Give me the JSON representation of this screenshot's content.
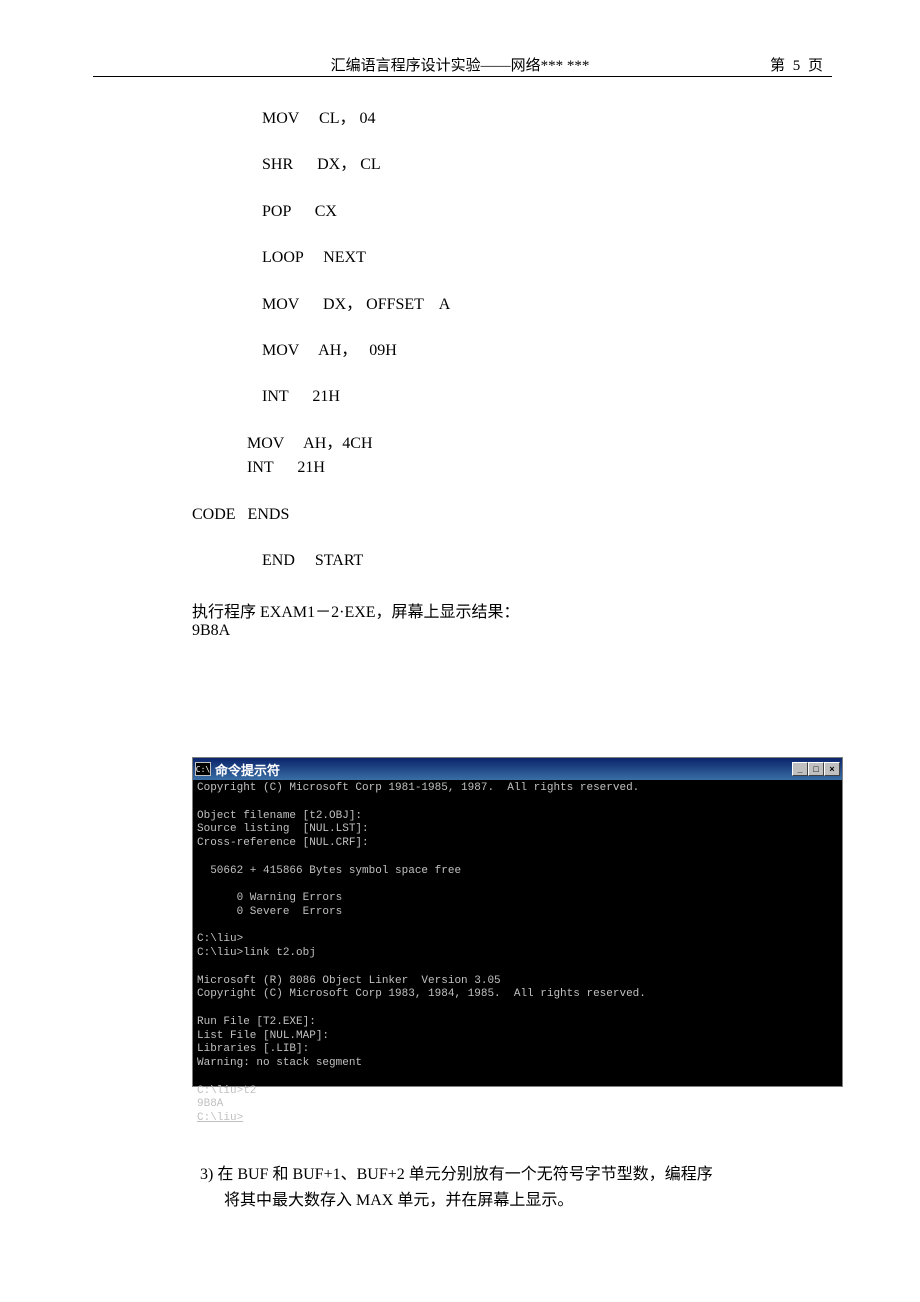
{
  "header": {
    "title": "汇编语言程序设计实验——网络*** ***",
    "page": "第 5 页"
  },
  "code": {
    "l1": "MOV     CL， 04",
    "l2": "SHR      DX， CL",
    "l3": "POP      CX",
    "l4": "LOOP     NEXT",
    "l5": "MOV      DX， OFFSET    A",
    "l6": "MOV     AH，   09H",
    "l7": "INT      21H",
    "l8": "MOV     AH，4CH",
    "l9": "INT      21H",
    "l10": "CODE   ENDS",
    "l11": "END     START"
  },
  "result": {
    "line1": "执行程序 EXAM1－2·EXE，屏幕上显示结果：",
    "line2": "9B8A"
  },
  "cmd": {
    "icon": "C:\\",
    "title": "命令提示符",
    "body": "Copyright (C) Microsoft Corp 1981-1985, 1987.  All rights reserved.\n\nObject filename [t2.OBJ]:\nSource listing  [NUL.LST]:\nCross-reference [NUL.CRF]:\n\n  50662 + 415866 Bytes symbol space free\n\n      0 Warning Errors\n      0 Severe  Errors\n\nC:\\liu>\nC:\\liu>link t2.obj\n\nMicrosoft (R) 8086 Object Linker  Version 3.05\nCopyright (C) Microsoft Corp 1983, 1984, 1985.  All rights reserved.\n\nRun File [T2.EXE]:\nList File [NUL.MAP]:\nLibraries [.LIB]:\nWarning: no stack segment\n\nC:\\liu>t2\n9B8A",
    "lastprompt": "C:\\liu>"
  },
  "footer": {
    "line1": "3)  在 BUF 和 BUF+1、BUF+2 单元分别放有一个无符号字节型数，编程序",
    "line2": "将其中最大数存入 MAX 单元，并在屏幕上显示。"
  },
  "btn": {
    "min": "_",
    "max": "□",
    "close": "×"
  }
}
